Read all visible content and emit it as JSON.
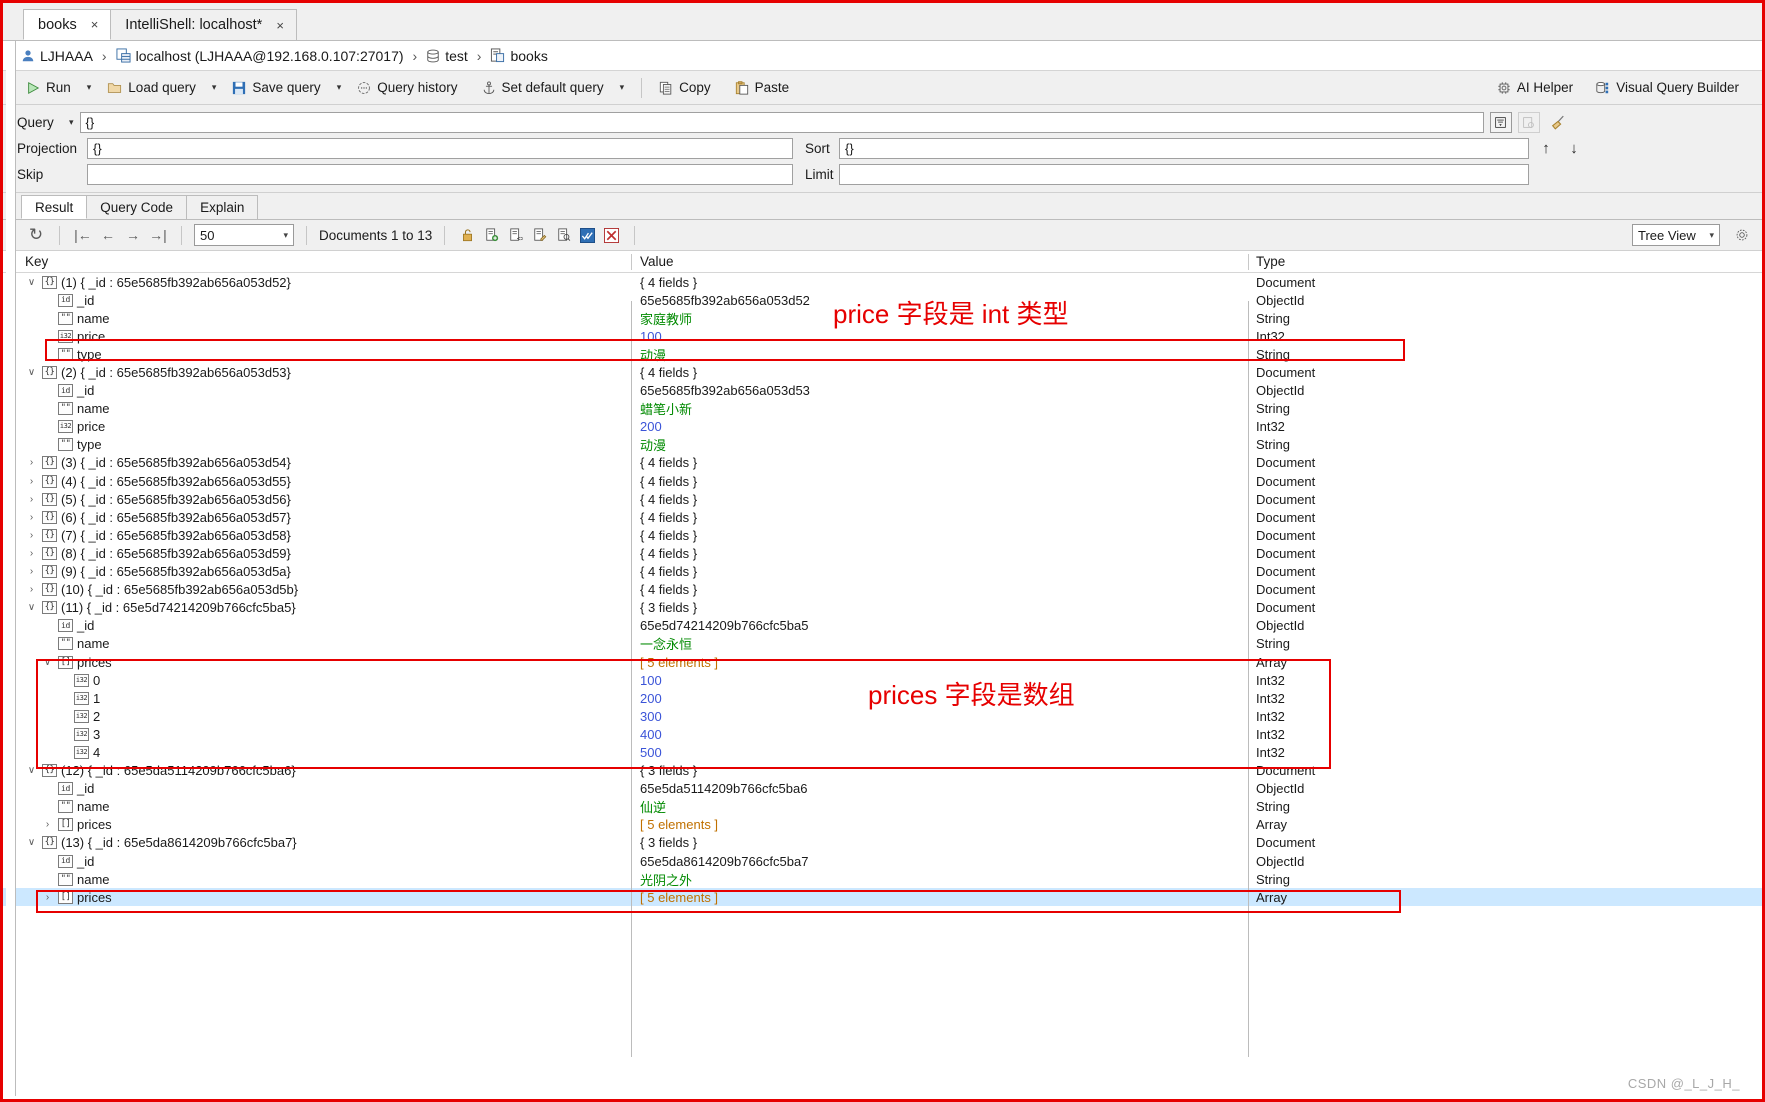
{
  "window": {
    "tabs": [
      {
        "label": "books",
        "close": "×",
        "active": true
      },
      {
        "label": "IntelliShell: localhost*",
        "close": "×",
        "active": false
      }
    ]
  },
  "breadcrumb": {
    "user": "LJHAAA",
    "server": "localhost (LJHAAA@192.168.0.107:27017)",
    "database": "test",
    "collection": "books",
    "separator": "›"
  },
  "toolbar": {
    "run": "Run",
    "load_query": "Load query",
    "save_query": "Save query",
    "query_history": "Query history",
    "set_default_query": "Set default query",
    "copy": "Copy",
    "paste": "Paste",
    "ai_helper": "AI Helper",
    "visual_query_builder": "Visual Query Builder",
    "dropdown_arrow": "▾"
  },
  "params": {
    "query_label": "Query",
    "query_value": "{}",
    "projection_label": "Projection",
    "projection_value": "{}",
    "sort_label": "Sort",
    "sort_value": "{}",
    "skip_label": "Skip",
    "skip_value": "",
    "limit_label": "Limit",
    "limit_value": "",
    "up_arrow": "↑",
    "down_arrow": "↓"
  },
  "result_tabs": [
    {
      "label": "Result",
      "active": true
    },
    {
      "label": "Query Code",
      "active": false
    },
    {
      "label": "Explain",
      "active": false
    }
  ],
  "result_toolbar": {
    "refresh": "↻",
    "first": "|←",
    "prev": "←",
    "next": "→",
    "last": "→|",
    "page_size": "50",
    "documents_info": "Documents 1 to 13",
    "tree_view": "Tree View",
    "chevron": "∨"
  },
  "columns": {
    "key": "Key",
    "value": "Value",
    "type": "Type"
  },
  "rows": [
    {
      "indent": 0,
      "twist": "∨",
      "icon": "doc",
      "key": "(1) { _id : 65e5685fb392ab656a053d52}",
      "value": "{ 4 fields }",
      "vclass": "v-plain",
      "type": "Document"
    },
    {
      "indent": 1,
      "twist": "",
      "icon": "idn",
      "key": "_id",
      "value": "65e5685fb392ab656a053d52",
      "vclass": "v-plain",
      "type": "ObjectId"
    },
    {
      "indent": 1,
      "twist": "",
      "icon": "strn",
      "key": "name",
      "value": "家庭教师",
      "vclass": "v-str",
      "type": "String"
    },
    {
      "indent": 1,
      "twist": "",
      "icon": "i32",
      "key": "price",
      "value": "100",
      "vclass": "v-num",
      "type": "Int32"
    },
    {
      "indent": 1,
      "twist": "",
      "icon": "strn",
      "key": "type",
      "value": "动漫",
      "vclass": "v-str",
      "type": "String"
    },
    {
      "indent": 0,
      "twist": "∨",
      "icon": "doc",
      "key": "(2) { _id : 65e5685fb392ab656a053d53}",
      "value": "{ 4 fields }",
      "vclass": "v-plain",
      "type": "Document"
    },
    {
      "indent": 1,
      "twist": "",
      "icon": "idn",
      "key": "_id",
      "value": "65e5685fb392ab656a053d53",
      "vclass": "v-plain",
      "type": "ObjectId"
    },
    {
      "indent": 1,
      "twist": "",
      "icon": "strn",
      "key": "name",
      "value": "蜡笔小新",
      "vclass": "v-str",
      "type": "String"
    },
    {
      "indent": 1,
      "twist": "",
      "icon": "i32",
      "key": "price",
      "value": "200",
      "vclass": "v-num",
      "type": "Int32"
    },
    {
      "indent": 1,
      "twist": "",
      "icon": "strn",
      "key": "type",
      "value": "动漫",
      "vclass": "v-str",
      "type": "String"
    },
    {
      "indent": 0,
      "twist": "›",
      "icon": "doc",
      "key": "(3) { _id : 65e5685fb392ab656a053d54}",
      "value": "{ 4 fields }",
      "vclass": "v-plain",
      "type": "Document"
    },
    {
      "indent": 0,
      "twist": "›",
      "icon": "doc",
      "key": "(4) { _id : 65e5685fb392ab656a053d55}",
      "value": "{ 4 fields }",
      "vclass": "v-plain",
      "type": "Document"
    },
    {
      "indent": 0,
      "twist": "›",
      "icon": "doc",
      "key": "(5) { _id : 65e5685fb392ab656a053d56}",
      "value": "{ 4 fields }",
      "vclass": "v-plain",
      "type": "Document"
    },
    {
      "indent": 0,
      "twist": "›",
      "icon": "doc",
      "key": "(6) { _id : 65e5685fb392ab656a053d57}",
      "value": "{ 4 fields }",
      "vclass": "v-plain",
      "type": "Document"
    },
    {
      "indent": 0,
      "twist": "›",
      "icon": "doc",
      "key": "(7) { _id : 65e5685fb392ab656a053d58}",
      "value": "{ 4 fields }",
      "vclass": "v-plain",
      "type": "Document"
    },
    {
      "indent": 0,
      "twist": "›",
      "icon": "doc",
      "key": "(8) { _id : 65e5685fb392ab656a053d59}",
      "value": "{ 4 fields }",
      "vclass": "v-plain",
      "type": "Document"
    },
    {
      "indent": 0,
      "twist": "›",
      "icon": "doc",
      "key": "(9) { _id : 65e5685fb392ab656a053d5a}",
      "value": "{ 4 fields }",
      "vclass": "v-plain",
      "type": "Document"
    },
    {
      "indent": 0,
      "twist": "›",
      "icon": "doc",
      "key": "(10) { _id : 65e5685fb392ab656a053d5b}",
      "value": "{ 4 fields }",
      "vclass": "v-plain",
      "type": "Document"
    },
    {
      "indent": 0,
      "twist": "∨",
      "icon": "doc",
      "key": "(11) { _id : 65e5d74214209b766cfc5ba5}",
      "value": "{ 3 fields }",
      "vclass": "v-plain",
      "type": "Document"
    },
    {
      "indent": 1,
      "twist": "",
      "icon": "idn",
      "key": "_id",
      "value": "65e5d74214209b766cfc5ba5",
      "vclass": "v-plain",
      "type": "ObjectId"
    },
    {
      "indent": 1,
      "twist": "",
      "icon": "strn",
      "key": "name",
      "value": "一念永恒",
      "vclass": "v-str",
      "type": "String"
    },
    {
      "indent": 1,
      "twist": "∨",
      "icon": "arr",
      "key": "prices",
      "value": "[ 5 elements ]",
      "vclass": "v-arr",
      "type": "Array"
    },
    {
      "indent": 2,
      "twist": "",
      "icon": "i32",
      "key": "0",
      "value": "100",
      "vclass": "v-num",
      "type": "Int32"
    },
    {
      "indent": 2,
      "twist": "",
      "icon": "i32",
      "key": "1",
      "value": "200",
      "vclass": "v-num",
      "type": "Int32"
    },
    {
      "indent": 2,
      "twist": "",
      "icon": "i32",
      "key": "2",
      "value": "300",
      "vclass": "v-num",
      "type": "Int32"
    },
    {
      "indent": 2,
      "twist": "",
      "icon": "i32",
      "key": "3",
      "value": "400",
      "vclass": "v-num",
      "type": "Int32"
    },
    {
      "indent": 2,
      "twist": "",
      "icon": "i32",
      "key": "4",
      "value": "500",
      "vclass": "v-num",
      "type": "Int32"
    },
    {
      "indent": 0,
      "twist": "∨",
      "icon": "doc",
      "key": "(12) { _id : 65e5da5114209b766cfc5ba6}",
      "value": "{ 3 fields }",
      "vclass": "v-plain",
      "type": "Document"
    },
    {
      "indent": 1,
      "twist": "",
      "icon": "idn",
      "key": "_id",
      "value": "65e5da5114209b766cfc5ba6",
      "vclass": "v-plain",
      "type": "ObjectId"
    },
    {
      "indent": 1,
      "twist": "",
      "icon": "strn",
      "key": "name",
      "value": "仙逆",
      "vclass": "v-str",
      "type": "String"
    },
    {
      "indent": 1,
      "twist": "›",
      "icon": "arr",
      "key": "prices",
      "value": "[ 5 elements ]",
      "vclass": "v-arr",
      "type": "Array"
    },
    {
      "indent": 0,
      "twist": "∨",
      "icon": "doc",
      "key": "(13) { _id : 65e5da8614209b766cfc5ba7}",
      "value": "{ 3 fields }",
      "vclass": "v-plain",
      "type": "Document"
    },
    {
      "indent": 1,
      "twist": "",
      "icon": "idn",
      "key": "_id",
      "value": "65e5da8614209b766cfc5ba7",
      "vclass": "v-plain",
      "type": "ObjectId"
    },
    {
      "indent": 1,
      "twist": "",
      "icon": "strn",
      "key": "name",
      "value": "光阴之外",
      "vclass": "v-str",
      "type": "String"
    },
    {
      "indent": 1,
      "twist": "›",
      "icon": "arr",
      "key": "prices",
      "value": "[ 5 elements ]",
      "vclass": "v-arr",
      "type": "Array",
      "selected": true
    }
  ],
  "annotations": {
    "price_note": "price 字段是 int 类型",
    "prices_note": "prices 字段是数组",
    "color": "#e60000"
  },
  "watermark": "CSDN @_L_J_H_"
}
